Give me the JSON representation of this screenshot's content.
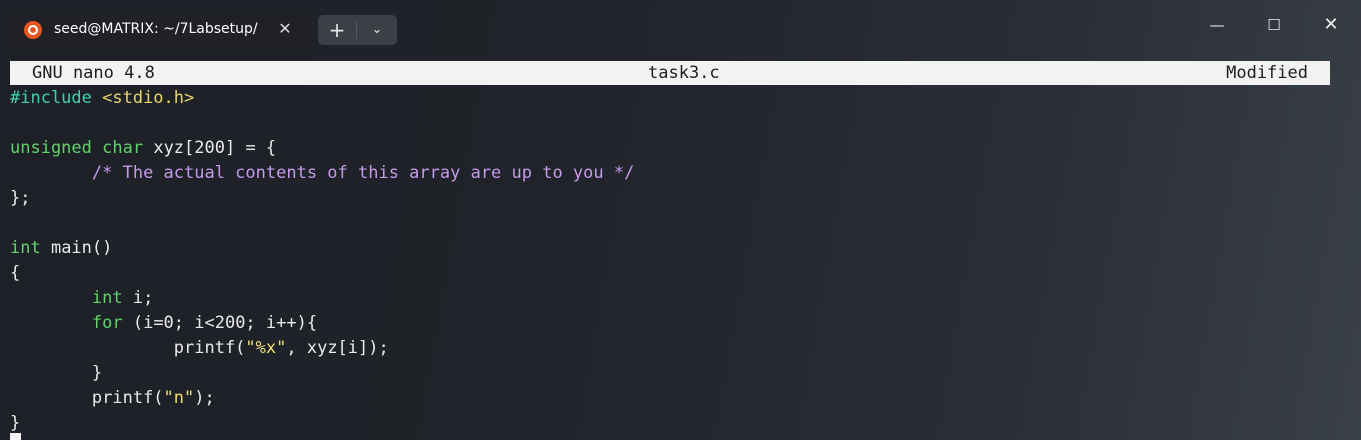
{
  "tab": {
    "title": "seed@MATRIX: ~/7Labsetup/",
    "close_glyph": "✕"
  },
  "toolbar": {
    "new_tab": "+",
    "dropdown": "⌄"
  },
  "window_controls": {
    "minimize": "—",
    "maximize": "☐",
    "close": "✕"
  },
  "nano": {
    "version": "GNU nano 4.8",
    "filename": "task3.c",
    "status": "Modified"
  },
  "code": {
    "l1_include": "#include",
    "l1_header": " <stdio.h>",
    "l3_kw1": "unsigned",
    "l3_kw2": "char",
    "l3_rest": " xyz[200] = {",
    "l4_comment": "/* The actual contents of this array are up to you */",
    "l5": "};",
    "l7_kw": "int",
    "l7_rest": " main()",
    "l8": "{",
    "l9_kw": "int",
    "l9_rest": " i;",
    "l10_kw": "for",
    "l10_rest": " (i=0; i<200; i++){",
    "l11_a": "printf(",
    "l11_str": "\"%x\"",
    "l11_b": ", xyz[i]);",
    "l12": "}",
    "l13_a": "printf(",
    "l13_str": "\"n\"",
    "l13_b": ");",
    "l14": "}"
  },
  "colors": {
    "keyword": "#5fd36a",
    "include": "#3fd0b0",
    "header": "#e8d66a",
    "comment": "#c59ae8",
    "string": "#f0df78",
    "ubuntu": "#e95420"
  }
}
